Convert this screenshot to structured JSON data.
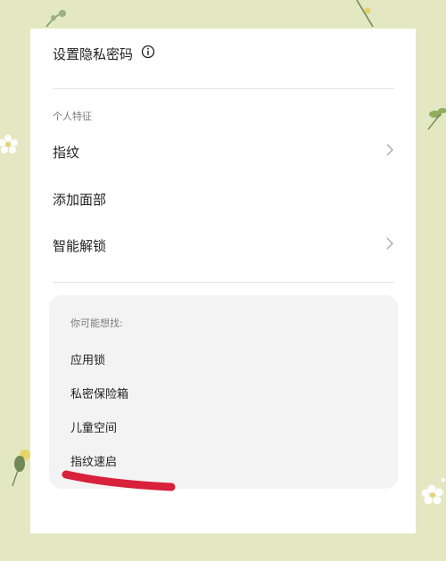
{
  "privacy": {
    "set_password_label": "设置隐私密码"
  },
  "features": {
    "section_label": "个人特征",
    "items": [
      {
        "label": "指纹",
        "icon": "chevron-right-icon"
      },
      {
        "label": "添加面部"
      },
      {
        "label": "智能解锁",
        "icon": "chevron-right-icon"
      }
    ]
  },
  "suggestions": {
    "title": "你可能想找:",
    "items": [
      "应用锁",
      "私密保险箱",
      "儿童空间",
      "指纹速启"
    ]
  },
  "colors": {
    "background": "#e3e8c2",
    "card": "#ffffff",
    "suggest_box": "#f3f3f3",
    "highlight_mark": "#d8213b"
  }
}
